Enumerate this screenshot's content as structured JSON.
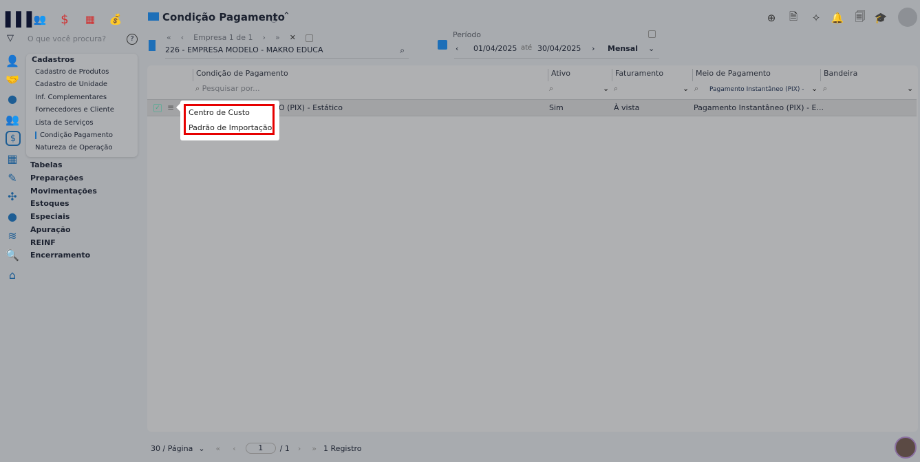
{
  "sidebar": {
    "search_placeholder": "O que você procura?",
    "menu_title": "Cadastros",
    "menu_items": [
      "Cadastro de Produtos",
      "Cadastro de Unidade",
      "Inf. Complementares",
      "Fornecedores e Cliente",
      "Lista de Serviços",
      "Condição Pagamento",
      "Natureza de Operação"
    ],
    "active_item": "Condição Pagamento",
    "sections": [
      "Tabelas",
      "Preparações",
      "Movimentações",
      "Estoques",
      "Especiais",
      "Apuração",
      "REINF",
      "Encerramento"
    ]
  },
  "header": {
    "title": "Condição Pagamento"
  },
  "empresa": {
    "nav_label": "Empresa 1 de 1",
    "value": "226 - EMPRESA MODELO - MAKRO EDUCA"
  },
  "periodo": {
    "label": "Período",
    "start": "01/04/2025",
    "sep": "até",
    "end": "30/04/2025",
    "mode": "Mensal"
  },
  "table": {
    "columns": [
      "Condição de Pagamento",
      "Ativo",
      "Faturamento",
      "Meio de Pagamento",
      "Bandeira"
    ],
    "search_placeholder": "Pesquisar por...",
    "meio_filter": "Pagamento Instantâneo (PIX) -",
    "rows": [
      {
        "condicao": "EO (PIX) - Estático",
        "ativo": "Sim",
        "faturamento": "À vista",
        "meio": "Pagamento Instantâneo (PIX) - E...",
        "bandeira": ""
      }
    ]
  },
  "context_menu": [
    "Centro de Custo",
    "Padrão de Importação"
  ],
  "footer": {
    "per_page": "30 / Página",
    "page": "1",
    "total_pages": "/ 1",
    "records": "1 Registro"
  },
  "colors": {
    "accent": "#1d6fb8",
    "highlight": "#e60000"
  }
}
